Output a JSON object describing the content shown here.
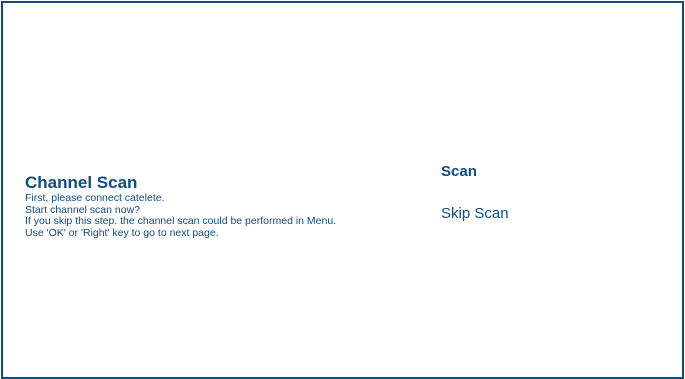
{
  "screen": {
    "title": "Channel Scan",
    "description_lines": [
      "First, please connect catelete.",
      "Start channel scan now?",
      "If you skip this step. the channel scan could be performed in Menu.",
      "Use 'OK' or 'Right' key to go to next page."
    ]
  },
  "options": {
    "items": [
      {
        "label": "Scan",
        "selected": true
      },
      {
        "label": "Skip Scan",
        "selected": false
      }
    ]
  },
  "colors": {
    "accent": "#0f4c81",
    "background": "#ffffff"
  }
}
